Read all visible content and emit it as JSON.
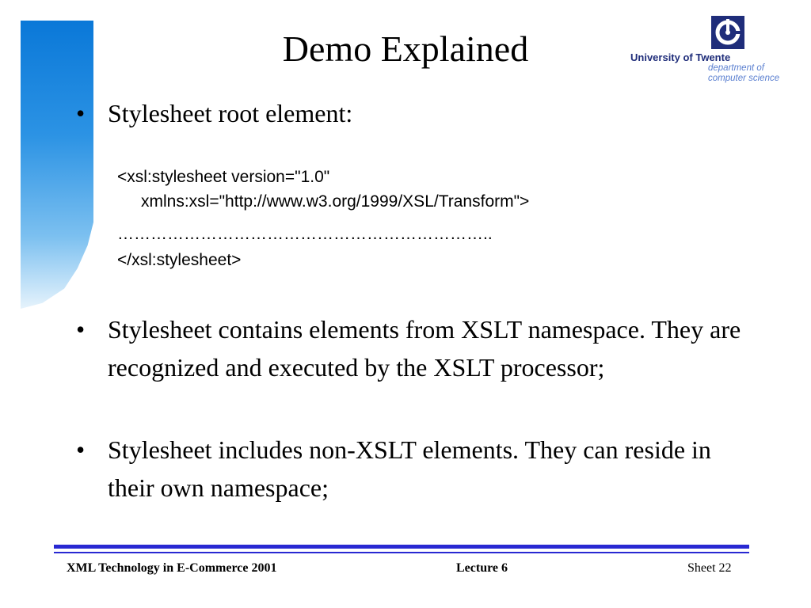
{
  "slide": {
    "title": "Demo Explained",
    "bullets": [
      "Stylesheet root element:",
      "Stylesheet contains elements from XSLT namespace. They are recognized and executed by the XSLT processor;",
      "Stylesheet includes non-XSLT elements. They can reside in their own namespace;"
    ],
    "bullet_glyph": "•",
    "code_lines": [
      "<xsl:stylesheet version=\"1.0\"",
      "xmlns:xsl=\"http://www.w3.org/1999/XSL/Transform\">",
      "…………………………………………………………..",
      "</xsl:stylesheet>"
    ]
  },
  "logo": {
    "name": "University of Twente",
    "dept_line1": "department of",
    "dept_line2": "computer science",
    "icon": "university-of-twente-emblem-icon"
  },
  "footer": {
    "course": "XML Technology in E-Commerce 2001",
    "lecture": "Lecture 6",
    "sheet": "Sheet 22"
  },
  "colors": {
    "accent_blue": "#2828d2",
    "gradient_top": "#0a78d8",
    "logo_text": "#1f2d7a",
    "logo_dept": "#5a7fd0"
  }
}
